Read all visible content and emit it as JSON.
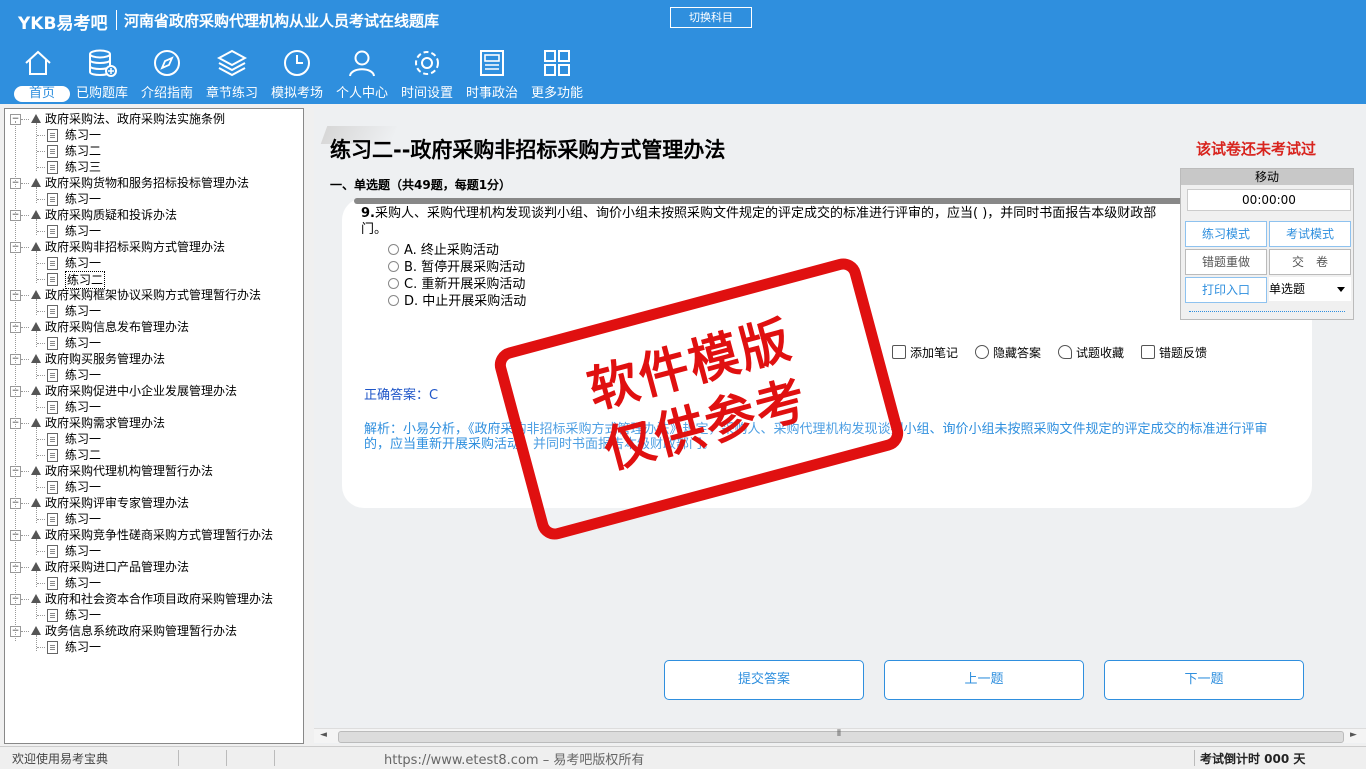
{
  "app": {
    "logo": "YKB易考吧",
    "title": "河南省政府采购代理机构从业人员考试在线题库",
    "switch_label": "切换科目"
  },
  "nav": [
    {
      "label": "首页",
      "icon": "home-icon",
      "active": true
    },
    {
      "label": "已购题库",
      "icon": "database-add-icon"
    },
    {
      "label": "介绍指南",
      "icon": "compass-icon"
    },
    {
      "label": "章节练习",
      "icon": "layers-icon"
    },
    {
      "label": "模拟考场",
      "icon": "clock-icon"
    },
    {
      "label": "个人中心",
      "icon": "user-icon"
    },
    {
      "label": "时间设置",
      "icon": "gear-icon"
    },
    {
      "label": "时事政治",
      "icon": "news-icon"
    },
    {
      "label": "更多功能",
      "icon": "grid-icon"
    }
  ],
  "tree": [
    {
      "label": "政府采购法、政府采购法实施条例",
      "children": [
        "练习一",
        "练习二",
        "练习三"
      ]
    },
    {
      "label": "政府采购货物和服务招标投标管理办法",
      "children": [
        "练习一"
      ]
    },
    {
      "label": "政府采购质疑和投诉办法",
      "children": [
        "练习一"
      ]
    },
    {
      "label": "政府采购非招标采购方式管理办法",
      "children": [
        "练习一",
        "练习二"
      ],
      "selected_child": 1
    },
    {
      "label": "政府采购框架协议采购方式管理暂行办法",
      "children": [
        "练习一"
      ]
    },
    {
      "label": "政府采购信息发布管理办法",
      "children": [
        "练习一"
      ]
    },
    {
      "label": "政府购买服务管理办法",
      "children": [
        "练习一"
      ]
    },
    {
      "label": "政府采购促进中小企业发展管理办法",
      "children": [
        "练习一"
      ]
    },
    {
      "label": "政府采购需求管理办法",
      "children": [
        "练习一",
        "练习二"
      ]
    },
    {
      "label": "政府采购代理机构管理暂行办法",
      "children": [
        "练习一"
      ]
    },
    {
      "label": "政府采购评审专家管理办法",
      "children": [
        "练习一"
      ]
    },
    {
      "label": "政府采购竞争性磋商采购方式管理暂行办法",
      "children": [
        "练习一"
      ]
    },
    {
      "label": "政府采购进口产品管理办法",
      "children": [
        "练习一"
      ]
    },
    {
      "label": "政府和社会资本合作项目政府采购管理办法",
      "children": [
        "练习一"
      ]
    },
    {
      "label": "政务信息系统政府采购管理暂行办法",
      "children": [
        "练习一"
      ]
    }
  ],
  "exercise": {
    "title": "练习二--政府采购非招标采购方式管理办法",
    "not_taken": "该试卷还未考试过",
    "section": "一、单选题（共49题，每题1分）",
    "question_number": "9.",
    "question": "采购人、采购代理机构发现谈判小组、询价小组未按照采购文件规定的评定成交的标准进行评审的，应当( )，并同时书面报告本级财政部门。",
    "options": [
      "A. 终止采购活动",
      "B. 暂停开展采购活动",
      "C. 重新开展采购活动",
      "D. 中止开展采购活动"
    ],
    "tools": [
      "添加笔记",
      "隐藏答案",
      "试题收藏",
      "错题反馈"
    ],
    "answer": "正确答案：C",
    "analysis": "解析：小易分析，《政府采购非招标采购方式管理办法》规定，采购人、采购代理机构发现谈判小组、询价小组未按照采购文件规定的评定成交的标准进行评审的，应当重新开展采购活动，并同时书面报告本级财政部门。"
  },
  "buttons": {
    "submit": "提交答案",
    "prev": "上一题",
    "next": "下一题"
  },
  "panel": {
    "header": "移动",
    "timer": "00:00:00",
    "practice_mode": "练习模式",
    "exam_mode": "考试模式",
    "redo_wrong": "错题重做",
    "hand_in": "交　卷",
    "print": "打印入口",
    "question_type": "单选题"
  },
  "watermark": {
    "line1": "软件模版",
    "line2": "仅供参考"
  },
  "status": {
    "welcome": "欢迎使用易考宝典",
    "copyright": "https://www.etest8.com – 易考吧版权所有",
    "countdown": "考试倒计时 000 天"
  }
}
